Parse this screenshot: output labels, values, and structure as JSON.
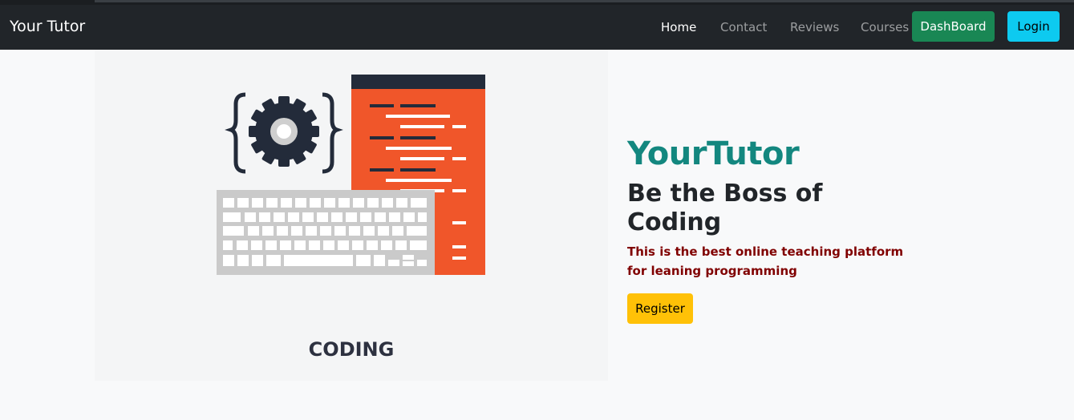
{
  "navbar": {
    "brand": "Your Tutor",
    "links": [
      {
        "label": "Home",
        "active": true
      },
      {
        "label": "Contact",
        "active": false
      },
      {
        "label": "Reviews",
        "active": false
      },
      {
        "label": "Courses",
        "active": false
      }
    ],
    "dashboard_label": "DashBoard",
    "login_label": "Login"
  },
  "hero": {
    "image_caption": "CODING",
    "title": "YourTutor",
    "subtitle": "Be the Boss of Coding",
    "description": "This is the best online teaching platform for leaning programming",
    "register_label": "Register"
  },
  "colors": {
    "navbar_bg": "#212529",
    "dashboard_btn": "#198754",
    "login_btn": "#0dcaf0",
    "register_btn": "#ffc107",
    "title_color": "#13877f",
    "description_color": "#800000",
    "code_panel": "#f0562a",
    "code_panel_header": "#232b3a"
  }
}
